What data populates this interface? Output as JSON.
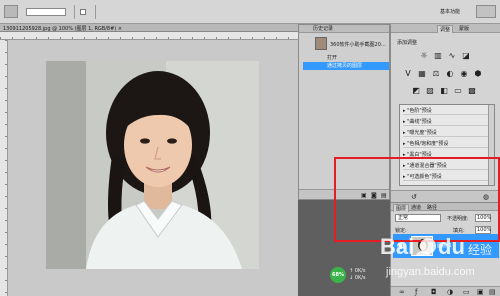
{
  "document": {
    "tab_title": "130911205928.jpg @ 100% (图层 1, RGB/8#) ×"
  },
  "workspace": {
    "label": "基本功能"
  },
  "history_panel": {
    "title": "历史记录",
    "snapshot_label": "360软件小助手截图20...",
    "rows": [
      {
        "label": "打开",
        "selected": false
      },
      {
        "label": "通过拷贝的图层",
        "selected": true
      }
    ]
  },
  "adjustments_panel": {
    "tabs": [
      "调整",
      "蒙版"
    ],
    "title": "添加调整",
    "presets": [
      "\"色阶\"预设",
      "\"曲线\"预设",
      "\"曝光度\"预设",
      "\"色相/饱和度\"预设",
      "\"黑白\"预设",
      "\"通道混合器\"预设",
      "\"可选颜色\"预设"
    ]
  },
  "layers_panel": {
    "tabs": [
      "图层",
      "通道",
      "路径"
    ],
    "blend_mode": "正常",
    "opacity_label": "不透明度:",
    "opacity_value": "100%",
    "lock_label": "锁定:",
    "fill_label": "填充:",
    "fill_value": "100%",
    "layer_name": "图层 1"
  },
  "status": {
    "percent": "68%",
    "upload": "0K/s",
    "download": "0K/s"
  },
  "watermark": {
    "brand": "Bai du 经验",
    "url": "jingyan.baidu.com"
  },
  "colors": {
    "selection": "#3399ff",
    "annotation": "#e51c23",
    "status_green": "#3bb34a"
  }
}
